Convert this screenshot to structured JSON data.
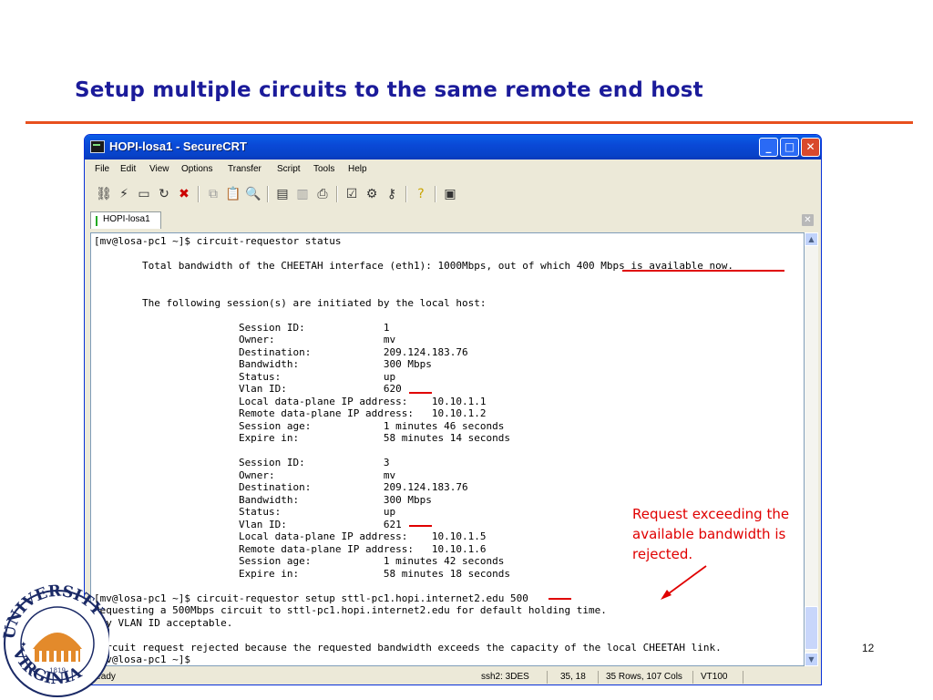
{
  "slide": {
    "title": "Setup multiple circuits to the same remote end host",
    "page_number": "12",
    "accent_color": "#e8501e",
    "title_color": "#1b1b9a"
  },
  "window": {
    "title": "HOPI-losa1 - SecureCRT",
    "controls": {
      "minimize": "_",
      "maximize": "□",
      "close": "✕"
    }
  },
  "menubar": [
    "File",
    "Edit",
    "View",
    "Options",
    "Transfer",
    "Script",
    "Tools",
    "Help"
  ],
  "toolbar": {
    "icons": [
      "connect-icon",
      "quick-connect-icon",
      "connect-tab-icon",
      "reconnect-icon",
      "disconnect-icon",
      "copy-icon",
      "paste-icon",
      "find-icon",
      "print-icon",
      "print-selection-icon",
      "print-setup-icon",
      "session-options-icon",
      "global-options-icon",
      "keymap-icon",
      "help-icon",
      "sftp-icon"
    ]
  },
  "tabs": [
    {
      "label": "HOPI-losa1"
    }
  ],
  "terminal": {
    "lines": [
      "[mv@losa-pc1 ~]$ circuit-requestor status",
      "",
      "        Total bandwidth of the CHEETAH interface (eth1): 1000Mbps, out of which 400 Mbps is available now.",
      "",
      "",
      "        The following session(s) are initiated by the local host:",
      "",
      "                        Session ID:             1",
      "                        Owner:                  mv",
      "                        Destination:            209.124.183.76",
      "                        Bandwidth:              300 Mbps",
      "                        Status:                 up",
      "                        Vlan ID:                620",
      "                        Local data-plane IP address:    10.10.1.1",
      "                        Remote data-plane IP address:   10.10.1.2",
      "                        Session age:            1 minutes 46 seconds",
      "                        Expire in:              58 minutes 14 seconds",
      "",
      "                        Session ID:             3",
      "                        Owner:                  mv",
      "                        Destination:            209.124.183.76",
      "                        Bandwidth:              300 Mbps",
      "                        Status:                 up",
      "                        Vlan ID:                621",
      "                        Local data-plane IP address:    10.10.1.5",
      "                        Remote data-plane IP address:   10.10.1.6",
      "                        Session age:            1 minutes 42 seconds",
      "                        Expire in:              58 minutes 18 seconds",
      "",
      "[mv@losa-pc1 ~]$ circuit-requestor setup sttl-pc1.hopi.internet2.edu 500",
      "Requesting a 500Mbps circuit to sttl-pc1.hopi.internet2.edu for default holding time.",
      "Any VLAN ID acceptable.",
      "",
      "Circuit request rejected because the requested bandwidth exceeds the capacity of the local CHEETAH link.",
      "[mv@losa-pc1 ~]$ "
    ]
  },
  "statusbar": {
    "state": "Ready",
    "protocol": "ssh2: 3DES",
    "cursor": "35, 18",
    "size": "35 Rows, 107 Cols",
    "emulation": "VT100"
  },
  "annotation": {
    "lines": [
      "Request exceeding the",
      "available bandwidth is",
      "rejected."
    ],
    "color": "#e00000"
  },
  "seal": {
    "text_top": "UNIVERSITY",
    "text_bottom": "VIRGINIA",
    "year": "1819"
  }
}
